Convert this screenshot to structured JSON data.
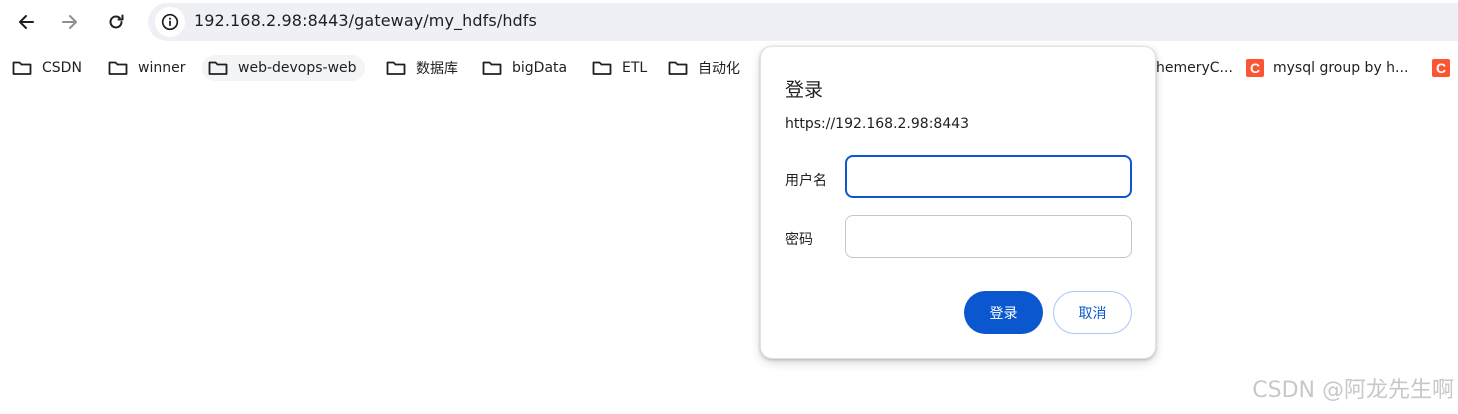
{
  "toolbar": {
    "back_icon": "arrow-left-icon",
    "forward_icon": "arrow-right-icon",
    "reload_icon": "reload-icon",
    "site_info_icon": "info-circle-icon",
    "url": "192.168.2.98:8443/gateway/my_hdfs/hdfs"
  },
  "bookmarks": [
    {
      "label": "CSDN",
      "icon": "folder-icon"
    },
    {
      "label": "winner",
      "icon": "folder-icon"
    },
    {
      "label": "web-devops-web",
      "icon": "folder-icon"
    },
    {
      "label": "数据库",
      "icon": "folder-icon"
    },
    {
      "label": "bigData",
      "icon": "folder-icon"
    },
    {
      "label": "ETL",
      "icon": "folder-icon"
    },
    {
      "label": "自动化",
      "icon": "folder-icon"
    },
    {
      "label": "hemeryC...",
      "icon": "none"
    },
    {
      "label": "mysql group by h...",
      "icon": "csdn-favicon"
    },
    {
      "label": "",
      "icon": "csdn-favicon"
    }
  ],
  "dialog": {
    "title": "登录",
    "origin": "https://192.168.2.98:8443",
    "username_label": "用户名",
    "username_value": "",
    "password_label": "密码",
    "password_value": "",
    "login_button": "登录",
    "cancel_button": "取消"
  },
  "watermark": "CSDN @阿龙先生啊",
  "colors": {
    "accent": "#0b57d0",
    "omnibox_bg": "#eef0f6",
    "csdn_brand": "#fc5531"
  }
}
